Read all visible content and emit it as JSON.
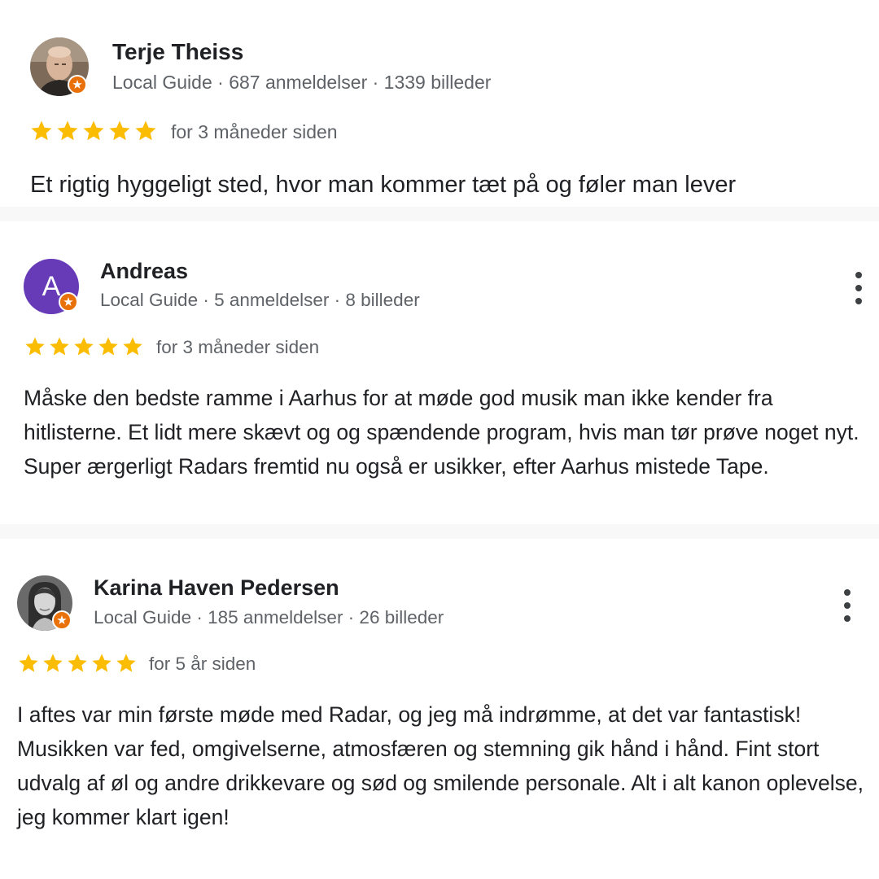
{
  "colors": {
    "star": "#fbbc04",
    "local_guide_badge": "#e8710a",
    "avatar_andreas": "#673ab7"
  },
  "reviews": [
    {
      "author": "Terje Theiss",
      "meta": "Local Guide · 687 anmeldelser · 1339 billeder",
      "avatar": "profile-photo",
      "rating": 5,
      "date": "for 3 måneder siden",
      "text": "Et rigtig hyggeligt sted, hvor man kommer tæt på og føler man lever"
    },
    {
      "author": "Andreas",
      "meta": "Local Guide · 5 anmeldelser · 8 billeder",
      "avatar": "A",
      "rating": 5,
      "date": "for 3 måneder siden",
      "text": "Måske den bedste ramme i Aarhus for at møde god musik man ikke kender fra hitlisterne. Et lidt mere skævt og og spændende program, hvis man tør prøve noget nyt. Super ærgerligt Radars fremtid nu også er usikker, efter Aarhus mistede Tape."
    },
    {
      "author": "Karina Haven Pedersen",
      "meta": "Local Guide · 185 anmeldelser · 26 billeder",
      "avatar": "profile-photo",
      "rating": 5,
      "date": "for 5 år siden",
      "text": "I aftes var min første møde med Radar, og jeg må indrømme, at det var fantastisk! Musikken var fed, omgivelserne, atmosfæren og stemning gik hånd i hånd. Fint stort udvalg af øl og andre drikkevare og sød og smilende personale. Alt i alt kanon oplevelse, jeg kommer klart igen!"
    }
  ]
}
